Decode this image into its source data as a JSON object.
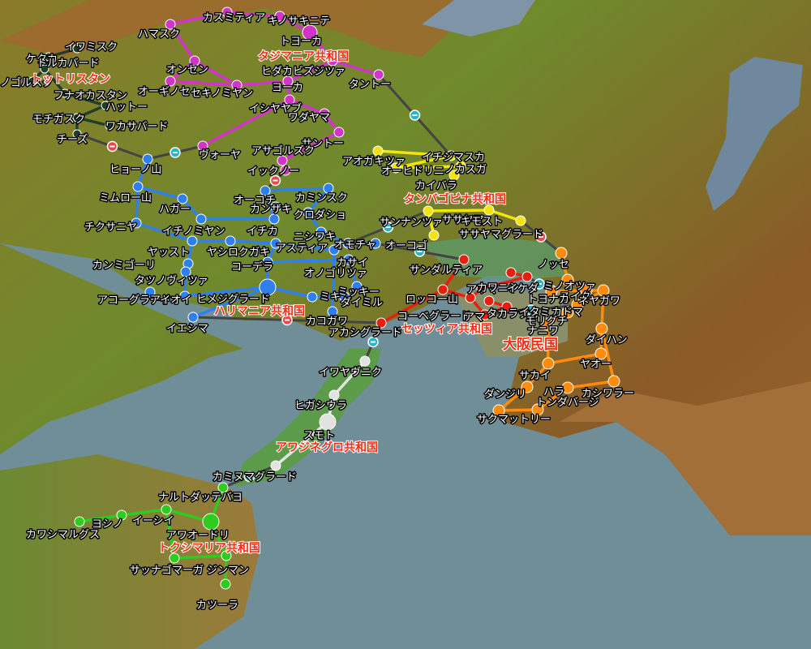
{
  "colors": {
    "tottori": "#1e3f2a",
    "tajima": "#d233c8",
    "tamba": "#f2e40c",
    "harima": "#2f80ee",
    "settsu": "#e61f10",
    "osaka": "#ff8c0c",
    "awaji": "#e2e2e2",
    "tokushima": "#2ecc1e",
    "connector": "#444444"
  },
  "countries": {
    "tottori": "トットリスタン",
    "tajima": "タジマニア共和国",
    "tamba": "タンバゴビナ共和国",
    "harima": "ハリマニア共和国",
    "settsu": "セッツィア共和国",
    "osaka": "大阪民国",
    "awaji": "アワジネグロ共和国",
    "tokushima": "トクシマリア共和国"
  },
  "stations": {
    "tottori": [
      "イワミスク",
      "ケタカ",
      "トルカバード",
      "ノゴルスク",
      "フナオカスタン",
      "ハットー",
      "モチガスク",
      "ワカサバード",
      "チーズ"
    ],
    "tajima": [
      "カスミティア",
      "キノサキニテ",
      "ハマスク",
      "トヨーカ",
      "オンセン",
      "ヒダカビズジツァ",
      "タントー",
      "オーギノセ",
      "セキノミヤン",
      "ヨーカ",
      "イシヤヤブ",
      "ワダヤマ",
      "サントー",
      "ヴォーヤ",
      "アサゴルズク",
      "イックノー"
    ],
    "tamba": [
      "アオガキツァ",
      "イチジマスカ",
      "オーヒドリニ",
      "ノカスガ",
      "カイバラ",
      "サンナンツァ",
      "ササヤマ",
      "キモスト",
      "ササヤマグラード"
    ],
    "harima": [
      "ヒョーノ山",
      "ミムロー山",
      "ハガー",
      "チクサニヤ",
      "オーコチ",
      "カンザキ",
      "カミンスク",
      "イチノミヤン",
      "イチカ",
      "クロダショ",
      "ヤッスト",
      "カンミゴーリ",
      "ニシワキ",
      "オモチャ",
      "オーコゴ",
      "タツノヴィツァ",
      "ヤシロクガキ",
      "アスティア",
      "カサイ",
      "コーデラ",
      "アコーグラード",
      "アイオイ",
      "ヒメジグラード",
      "オノゴリツァ",
      "イエシマ",
      "カコガワ",
      "ミッキー",
      "ミキ",
      "ダイミル"
    ],
    "settsu": [
      "サンダルティア",
      "ロッコー山",
      "コーベグラード",
      "アリマ",
      "アカシグラード",
      "カワニシ",
      "イケダ",
      "タカラヅカ",
      "イタミ",
      "アマ"
    ],
    "osaka": [
      "ノッセ",
      "ミノオツァ",
      "スイタ",
      "ネヤガワ",
      "トヨナカ",
      "カドマ",
      "モリグチ",
      "ナニワ",
      "ダイハン",
      "ヤオー",
      "サカイ",
      "ダンジリ",
      "ハラ",
      "カシワラー",
      "トンダバージ",
      "サクマットリー"
    ],
    "awaji": [
      "イワヤヴニク",
      "ヒガシウラ",
      "スモト",
      "カミヌマグラード"
    ],
    "tokushima": [
      "ナルトダッテバヨ",
      "カワシマルグス",
      "ヨシノ",
      "イーシイ",
      "アワオードリ",
      "サッナゴマーガ",
      "ジンマン",
      "カツーラ"
    ]
  }
}
